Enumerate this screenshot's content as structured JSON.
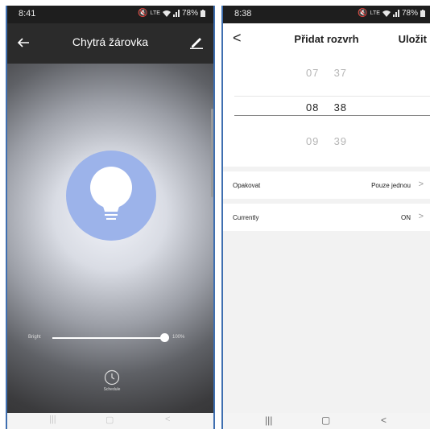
{
  "left": {
    "status": {
      "time": "8:41",
      "network": "LTE",
      "battery": "78%"
    },
    "appbar": {
      "title": "Chytrá žárovka"
    },
    "bulb": {
      "color": "#9cb3ea"
    },
    "brightness": {
      "label": "Bright",
      "value_text": "100%",
      "value": 1.0
    },
    "schedule": {
      "label": "Schedule"
    },
    "navbar": {
      "recent": "|||",
      "home": "▢",
      "back": "<"
    }
  },
  "right": {
    "status": {
      "time": "8:38",
      "network": "LTE",
      "battery": "78%"
    },
    "header": {
      "back": "<",
      "title": "Přidat rozvrh",
      "save": "Uložit"
    },
    "picker": {
      "rows": [
        {
          "h": "07",
          "m": "37"
        },
        {
          "h": "08",
          "m": "38"
        },
        {
          "h": "09",
          "m": "39"
        }
      ]
    },
    "repeat": {
      "label": "Opakovat",
      "value": "Pouze jednou"
    },
    "currently": {
      "label": "Currently",
      "value": "ON"
    },
    "navbar": {
      "recent": "|||",
      "home": "▢",
      "back": "<"
    }
  },
  "colors": {
    "frame_border": "#3f6fb0",
    "dark_bg": "#2a2a2a",
    "bulb": "#9cb3ea"
  },
  "icons": [
    "back-arrow-icon",
    "edit-pencil-icon",
    "bulb-icon",
    "clock-icon",
    "chevron-right-icon",
    "wifi-icon",
    "signal-icon",
    "battery-icon"
  ]
}
